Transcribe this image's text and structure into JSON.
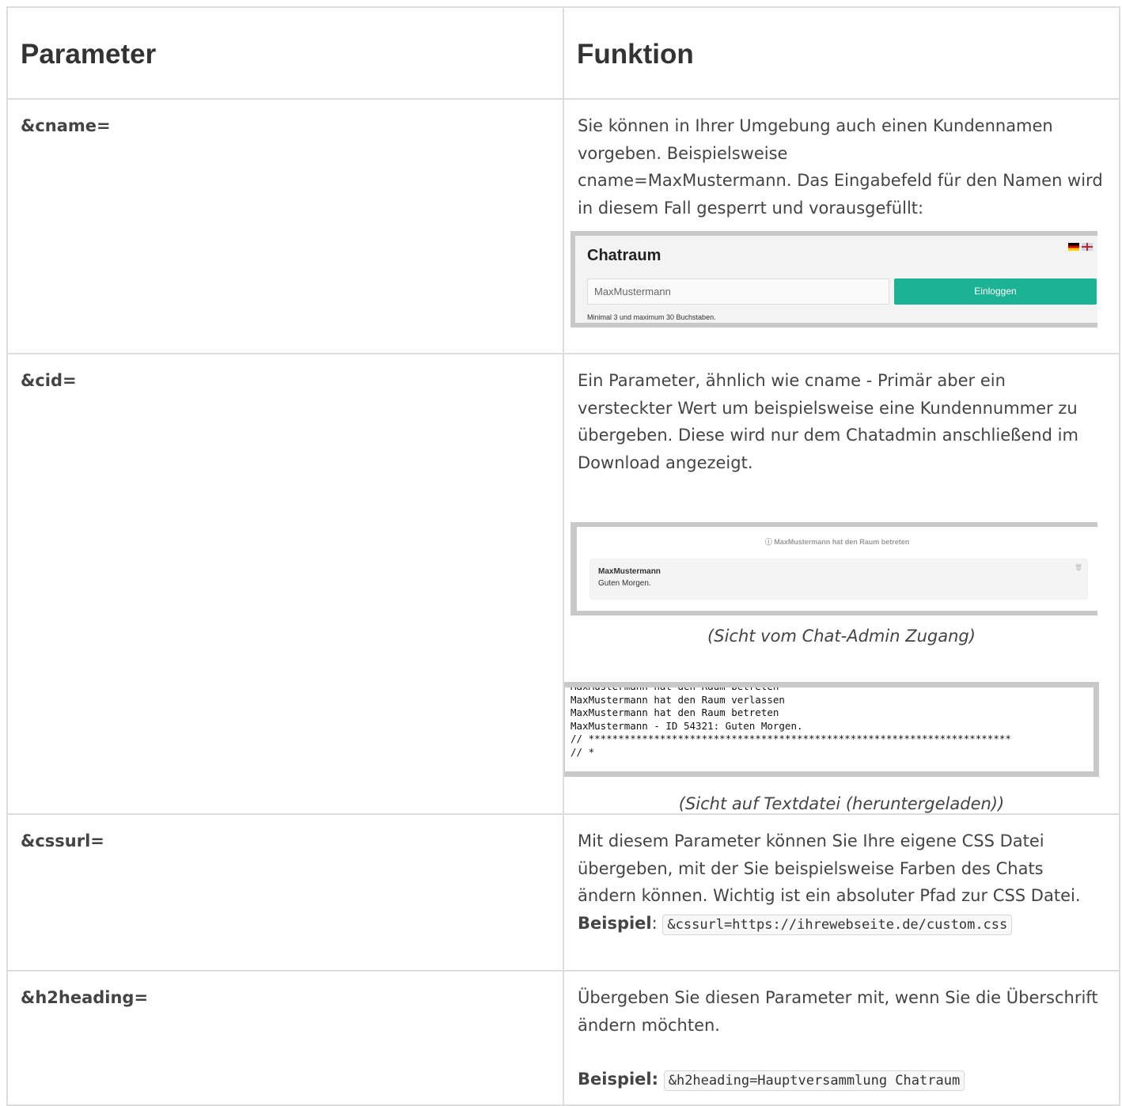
{
  "table": {
    "header": {
      "param": "Parameter",
      "function": "Funktion"
    },
    "rows": [
      {
        "param": "&cname=",
        "desc": "Sie können in Ihrer Umgebung auch einen Kundennamen vorgeben. Beispielsweise",
        "desc2": "cname=MaxMustermann. Das Eingabefeld für den Namen wird in diesem Fall gesperrt und vorausgefüllt:",
        "screenshot": {
          "title": "Chatraum",
          "input_value": "MaxMustermann",
          "button": "Einloggen",
          "hint": "Minimal 3 und maximum 30 Buchstaben."
        }
      },
      {
        "param": "&cid=",
        "desc": "Ein Parameter, ähnlich wie cname - Primär aber ein versteckter Wert um beispielsweise eine Kundennummer zu übergeben. Diese wird nur dem Chatadmin anschließend im Download angezeigt.",
        "admin_screenshot": {
          "join_notice": "MaxMustermann hat den Raum betreten",
          "author": "MaxMustermann",
          "message": "Guten Morgen."
        },
        "caption1": "(Sicht vom Chat-Admin Zugang)",
        "textfile": "MaxMustermann hat den Raum betreten\nMaxMustermann hat den Raum verlassen\nMaxMustermann hat den Raum betreten\nMaxMustermann - ID 54321: Guten Morgen.\n// ***********************************************************************\n// *",
        "caption2": "(Sicht auf Textdatei (heruntergeladen))"
      },
      {
        "param": "&cssurl=",
        "desc": "Mit diesem Parameter können Sie Ihre eigene CSS Datei übergeben, mit der Sie beispielsweise Farben des Chats ändern können. Wichtig ist ein absoluter Pfad zur CSS Datei.",
        "example_label": "Beispiel",
        "example_sep": ": ",
        "example_code": "&cssurl=https://ihrewebseite.de/custom.css"
      },
      {
        "param": "&h2heading=",
        "desc": "Übergeben Sie diesen Parameter mit, wenn Sie die Überschrift ändern möchten.",
        "example_label": "Beispiel:",
        "example_code": "&h2heading=Hauptversammlung Chatraum"
      }
    ]
  },
  "icons": {
    "info": "info-icon",
    "trash": "trash-icon",
    "flag_de": "flag-de-icon",
    "flag_uk": "flag-uk-icon"
  },
  "colors": {
    "accent": "#1bb394",
    "border": "#dddddd",
    "text": "#444444"
  }
}
